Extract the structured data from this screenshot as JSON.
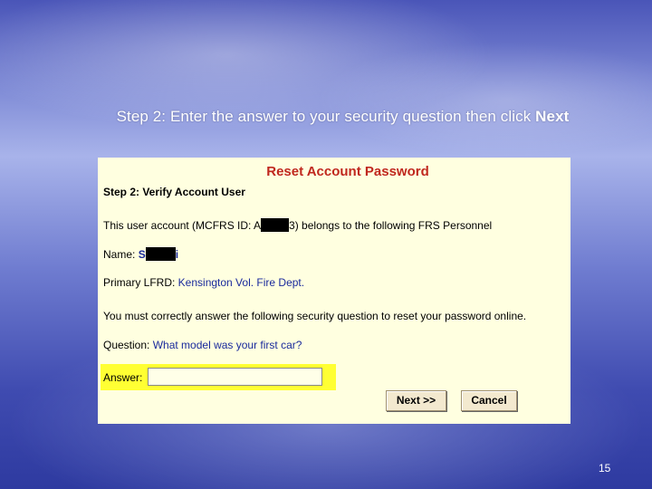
{
  "slide": {
    "instruction_prefix": "Step 2:  Enter the answer to your security question then click ",
    "instruction_emphasis": "Next",
    "page_number": "15"
  },
  "form": {
    "heading": "Reset Account Password",
    "step": "Step 2: Verify Account User",
    "account_line": {
      "prefix": "This user account (MCFRS ID: A",
      "suffix": "3) belongs to the following FRS Personnel"
    },
    "name": {
      "label": "Name: ",
      "value_start": "S",
      "value_end": "i"
    },
    "primary_lfrd": {
      "label": "Primary LFRD: ",
      "value": "Kensington Vol. Fire Dept."
    },
    "instruction": "You must correctly answer the following security question to reset your password online.",
    "question": {
      "label": "Question: ",
      "value": "What model was your first car?"
    },
    "answer": {
      "label": "Answer:",
      "value": ""
    },
    "buttons": {
      "next": "Next >>",
      "cancel": "Cancel"
    }
  },
  "colors": {
    "panel_background": "#ffffe0",
    "heading_red": "#c0281e",
    "value_blue": "#1a2a9c",
    "answer_highlight": "#ffff33"
  }
}
